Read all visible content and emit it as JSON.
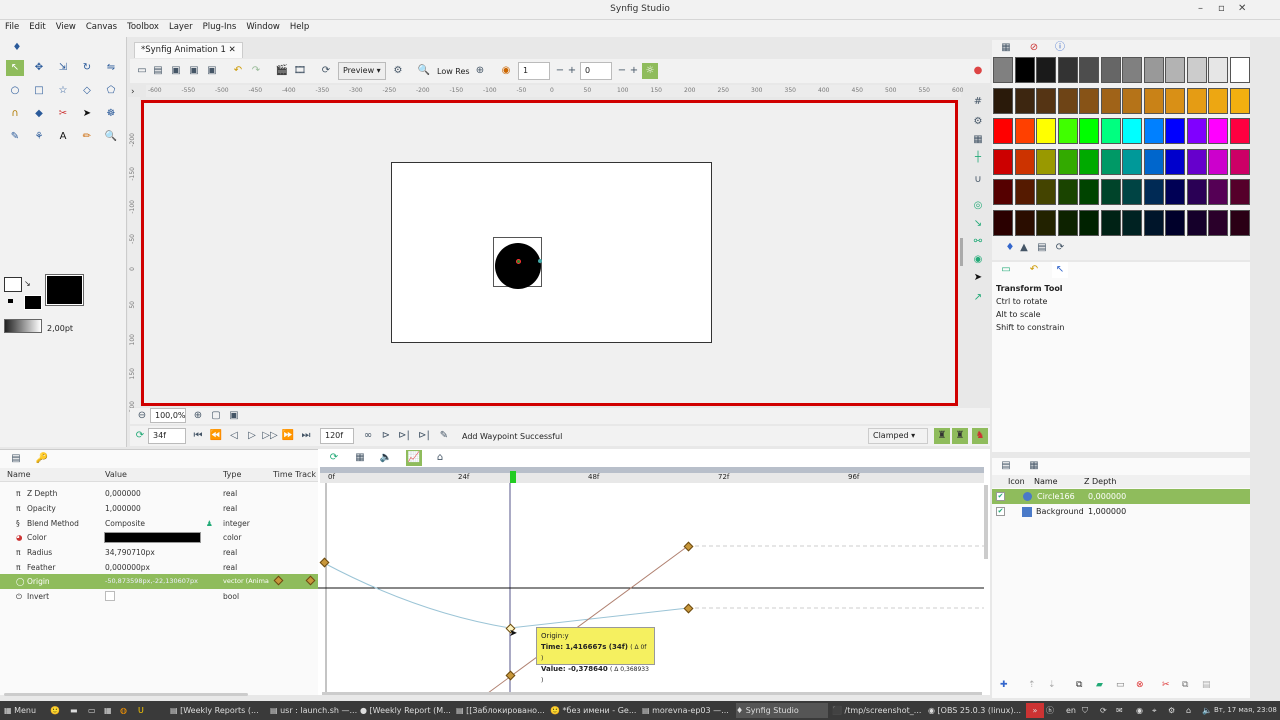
{
  "window": {
    "title": "Synfig Studio"
  },
  "menu": [
    "File",
    "Edit",
    "View",
    "Canvas",
    "Toolbox",
    "Layer",
    "Plug-Ins",
    "Window",
    "Help"
  ],
  "document_tab": {
    "label": "*Synfig Animation 1"
  },
  "canvas_toolbar": {
    "render_mode": "Preview",
    "res_label": "Low Res",
    "field1": "1",
    "field2": "0"
  },
  "ruler_h": [
    "-600",
    "-550",
    "-500",
    "-450",
    "-400",
    "-350",
    "-300",
    "-250",
    "-200",
    "-150",
    "-100",
    "-50",
    "0",
    "50",
    "100",
    "150",
    "200",
    "250",
    "300",
    "350",
    "400",
    "450",
    "500",
    "550",
    "600"
  ],
  "ruler_v": [
    "-200",
    "-150",
    "-100",
    "-50",
    "0",
    "50",
    "100",
    "150",
    "200"
  ],
  "toolbox": {
    "brush_size": "2,00pt"
  },
  "statusbar": {
    "zoom": "100,0%"
  },
  "timebar": {
    "current_frame": "34f",
    "end_frame": "120f",
    "message": "Add Waypoint Successful",
    "interpolation": "Clamped"
  },
  "params": {
    "headers": {
      "name": "Name",
      "value": "Value",
      "type": "Type",
      "timetrack": "Time Track"
    },
    "rows": [
      {
        "name": "Z Depth",
        "value": "0,000000",
        "type": "real"
      },
      {
        "name": "Opacity",
        "value": "1,000000",
        "type": "real"
      },
      {
        "name": "Blend Method",
        "value": "Composite",
        "type": "integer"
      },
      {
        "name": "Color",
        "value": "",
        "type": "color"
      },
      {
        "name": "Radius",
        "value": "34,790710px",
        "type": "real"
      },
      {
        "name": "Feather",
        "value": "0,000000px",
        "type": "real"
      },
      {
        "name": "Origin",
        "value": "-50,873598px,-22,130607px",
        "type": "vector (Anima"
      },
      {
        "name": "Invert",
        "value": "",
        "type": "bool"
      }
    ]
  },
  "timeline": {
    "labels": [
      "0f",
      "24f",
      "48f",
      "72f",
      "96f"
    ]
  },
  "tooltip": {
    "title": "Origin:y",
    "time": "Time: 1,416667s (34f)",
    "time_delta": "( Δ 0f )",
    "value": "Value: -0,378640",
    "value_delta": "( Δ 0,368933 )"
  },
  "tool_options": {
    "title": "Transform Tool",
    "lines": [
      "Ctrl to rotate",
      "Alt to scale",
      "Shift to constrain"
    ]
  },
  "layers": {
    "headers": {
      "icon": "Icon",
      "name": "Name",
      "zdepth": "Z Depth"
    },
    "rows": [
      {
        "name": "Circle166",
        "zdepth": "0,000000"
      },
      {
        "name": "Background",
        "zdepth": "1,000000"
      }
    ]
  },
  "taskbar": {
    "start": "Menu",
    "tasks": [
      "[Weekly Reports (...",
      "usr : launch.sh —...",
      "[Weekly Report (M...",
      "[[Заблокировано...",
      "*без имени - Ge...",
      "morevna-ep03 —...",
      "Synfig Studio",
      "/tmp/screenshot_...",
      "[OBS 25.0.3 (linux)..."
    ],
    "lang": "en",
    "clock": "Вт, 17 мая, 23:08"
  },
  "colors": {
    "accent": "#8fbc5c",
    "canvas_border": "#d00000",
    "tooltip": "#f5f060"
  }
}
